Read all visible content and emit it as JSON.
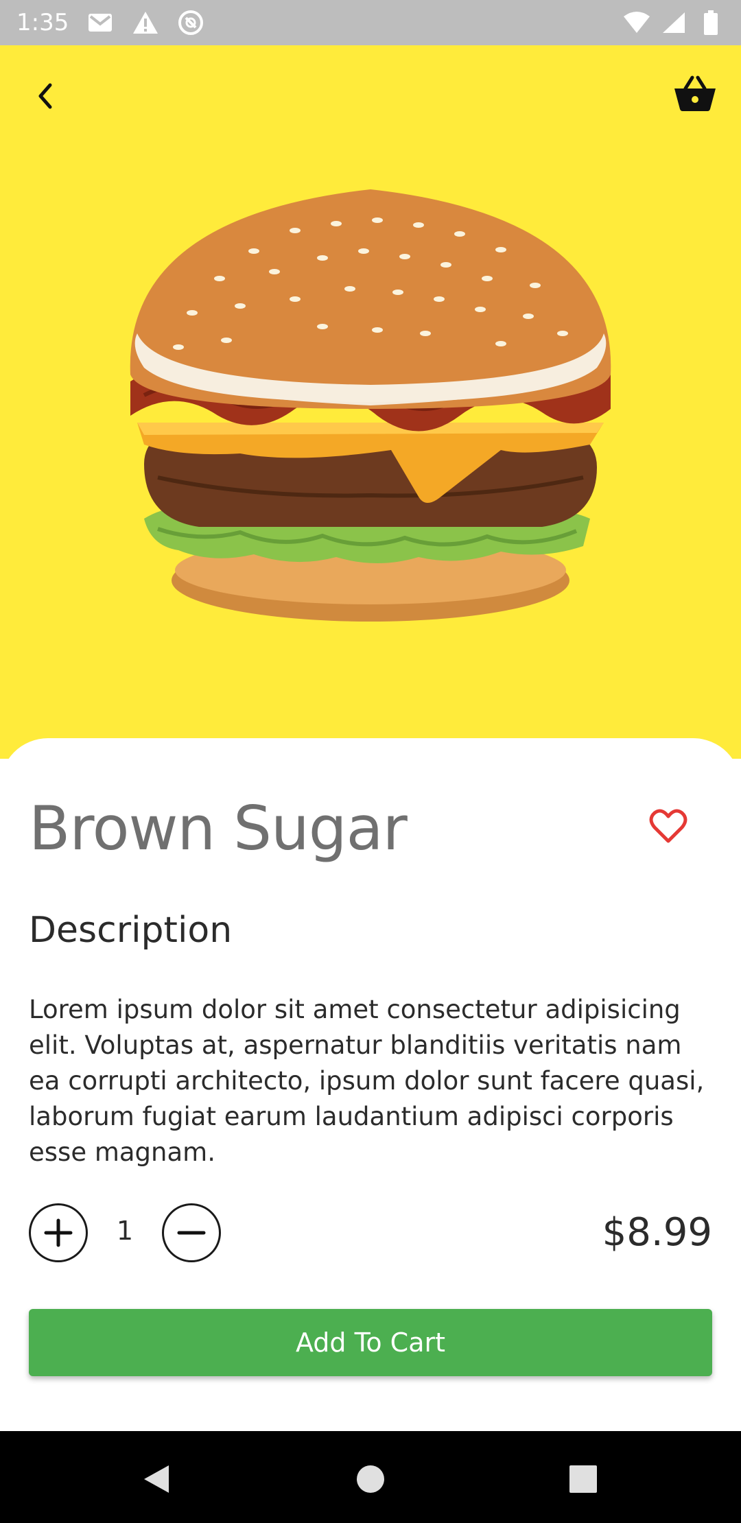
{
  "status_bar": {
    "time": "1:35",
    "icons": [
      "gmail-icon",
      "warning-icon",
      "sync-off-icon",
      "wifi-icon",
      "signal-icon",
      "battery-icon"
    ]
  },
  "header": {
    "back_icon": "chevron-left-icon",
    "cart_icon": "basket-icon"
  },
  "product": {
    "name": "Brown Sugar",
    "image": "burger-image",
    "favorite_icon": "heart-outline-icon",
    "description_heading": "Description",
    "description": "Lorem ipsum dolor sit amet consectetur adipisicing elit. Voluptas at, aspernatur blanditiis veritatis nam ea corrupti architecto, ipsum dolor sunt facere quasi, laborum fugiat earum laudantium adipisci corporis esse magnam.",
    "quantity": "1",
    "price": "$8.99"
  },
  "actions": {
    "add_to_cart_label": "Add To Cart"
  },
  "colors": {
    "hero_background": "#ffeb3b",
    "accent_green": "#4caf50",
    "heart_red": "#e53935"
  },
  "nav_bar": {
    "icons": [
      "nav-back-icon",
      "nav-home-icon",
      "nav-recents-icon"
    ]
  }
}
